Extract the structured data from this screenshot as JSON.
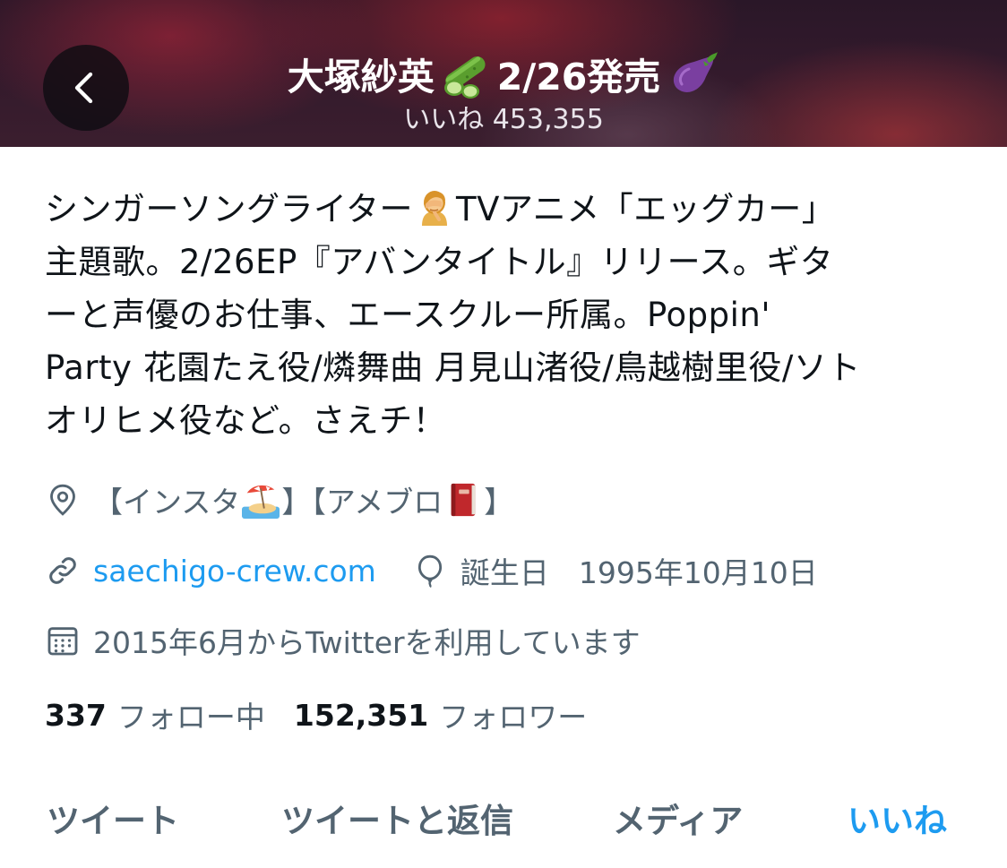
{
  "header": {
    "title_name": "大塚紗英",
    "title_release": "2/26発売",
    "likes_label": "いいね 453,355",
    "cucumber_icon": "cucumber-emoji",
    "eggplant_icon": "eggplant-emoji"
  },
  "bio": {
    "line1_a": "シンガーソングライター",
    "line1_b": "TVアニメ「エッグカー」",
    "line2": "主題歌。2/26EP『アバンタイトル』リリース。ギタ",
    "line3": "ーと声優のお仕事、エースクルー所属。Poppin'",
    "line4": "Party 花園たえ役/燐舞曲 月見山渚役/鳥越樹里役/ソト",
    "line5": "オリヒメ役など。さえチ！"
  },
  "meta": {
    "location_a": "【インスタ",
    "location_b": "】【アメブロ",
    "location_c": "】",
    "website": "saechigo-crew.com",
    "birthday": "誕生日　1995年10月10日",
    "joined": "2015年6月からTwitterを利用しています"
  },
  "stats": {
    "following_count": "337",
    "following_label": "フォロー中",
    "followers_count": "152,351",
    "followers_label": "フォロワー"
  },
  "tabs": {
    "tweets": "ツイート",
    "replies": "ツイートと返信",
    "media": "メディア",
    "likes": "いいね"
  },
  "colors": {
    "accent": "#1d9bf0",
    "secondary_text": "#536471",
    "primary_text": "#0f1419"
  }
}
